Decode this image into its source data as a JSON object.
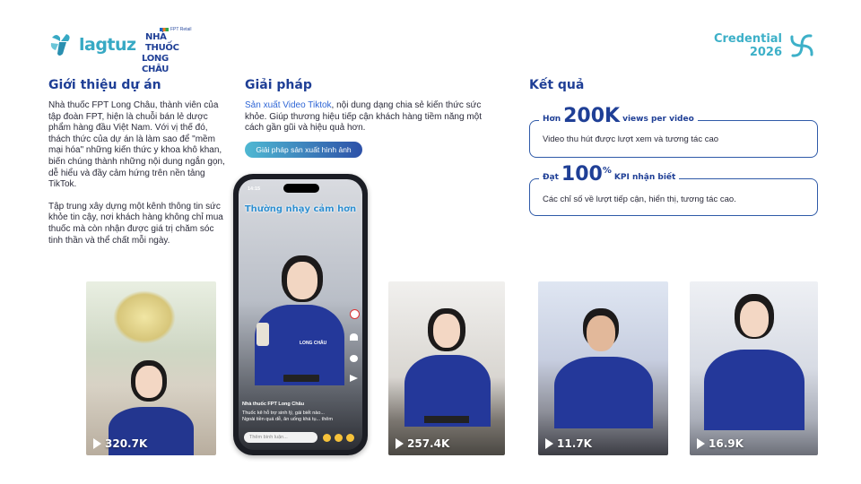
{
  "header": {
    "brand_lagtuz": "lagtuz",
    "brand_fpt_small": "FPT Retail",
    "brand_lc_line1": "NHÀ THUỐC",
    "brand_lc_line2": "LONG CHÂU",
    "credential_line1": "Credential",
    "credential_line2": "2026"
  },
  "intro": {
    "heading": "Giới thiệu dự án",
    "p1": "Nhà thuốc FPT Long Châu, thành viên của tập đoàn FPT, hiện là chuỗi bán lẻ dược phẩm hàng đầu Việt Nam. Với vị thế đó, thách thức của dự án là làm sao để \"mềm mại hóa\" những kiến thức y khoa khô khan, biến chúng thành những nội dung ngắn gọn, dễ hiểu và đầy cảm hứng trên nền tảng TikTok.",
    "p2": "Tập trung xây dựng một kênh thông tin sức khỏe tin cậy, nơi khách hàng không chỉ mua thuốc mà còn nhận được giá trị chăm sóc tinh thần và thể chất mỗi ngày."
  },
  "solution": {
    "heading": "Giải pháp",
    "link_text": "Sản xuất Video Tiktok",
    "text": ", nội dung dạng chia sẻ kiến thức sức khỏe. Giúp thương hiệu tiếp cận khách hàng tiềm năng một cách gần gũi và hiệu quả hơn.",
    "button_label": "Giải pháp sản xuất hình ảnh"
  },
  "results": {
    "heading": "Kết quả",
    "r1_prefix": "Hơn",
    "r1_big": "200K",
    "r1_suffix": "views per video",
    "r1_desc": "Video thu hút được lượt xem và tương tác cao",
    "r2_prefix": "Đạt",
    "r2_big": "100",
    "r2_sup": "%",
    "r2_suffix": "KPI nhận biết",
    "r2_desc": "Các chỉ số về lượt tiếp cận, hiển thị, tương tác cao."
  },
  "phone": {
    "time": "14:15",
    "caption": "Thường nhạy cảm hơn",
    "account": "Nhà thuốc FPT Long Châu",
    "desc": "Thuốc kê hỗ trợ sinh lý, gái biết nào... Ngoài tiền quá dễ, ăn uống khá tụ... thêm",
    "comment_placeholder": "Thêm bình luận...",
    "shirt_text": "LONG CHÂU"
  },
  "videos": [
    {
      "views": "320.7K"
    },
    {
      "views": "257.4K"
    },
    {
      "views": "11.7K"
    },
    {
      "views": "16.9K"
    }
  ],
  "colors": {
    "brand_blue": "#1f3f96",
    "brand_teal": "#3db0c8",
    "box_border": "#2f5aa8"
  }
}
